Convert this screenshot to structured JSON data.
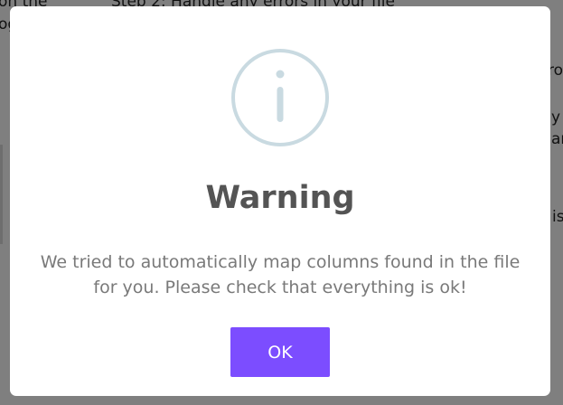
{
  "background": {
    "left_line_1": "on the",
    "left_line_2": "og",
    "step_heading": "Step 2: Handle any errors in your file",
    "right_line_1": "ro",
    "right_line_2": "y",
    "right_line_3": "ar",
    "right_line_4": "is"
  },
  "dialog": {
    "icon": "info-icon",
    "title": "Warning",
    "message": "We tried to automatically map columns found in the file for you. Please check that everything is ok!",
    "ok_label": "OK"
  },
  "colors": {
    "accent": "#7c4dff",
    "icon": "#c9dae1",
    "title": "#545454",
    "message": "#797979"
  }
}
